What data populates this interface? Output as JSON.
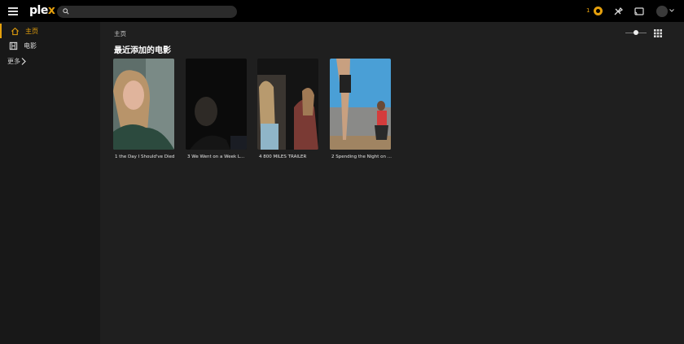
{
  "topbar": {
    "logo_main": "ple",
    "logo_accent": "x",
    "search_placeholder": "",
    "activity_count": "1"
  },
  "sidebar": {
    "items": [
      {
        "label": "主页",
        "icon": "home-icon",
        "active": true
      },
      {
        "label": "电影",
        "icon": "film-icon",
        "active": false
      }
    ],
    "more_label": "更多"
  },
  "main": {
    "breadcrumb": "主页",
    "section_title": "最近添加的电影",
    "movies": [
      {
        "title": "1 the Day I Should've Died"
      },
      {
        "title": "3 We Went on a Week L..."
      },
      {
        "title": "4 800 MILES TRAILER"
      },
      {
        "title": "2 Spending the Night on ..."
      }
    ]
  },
  "colors": {
    "accent": "#e5a00d",
    "topbar_bg": "#000000",
    "sidebar_bg": "#181818",
    "main_bg": "#1f1f1f"
  }
}
